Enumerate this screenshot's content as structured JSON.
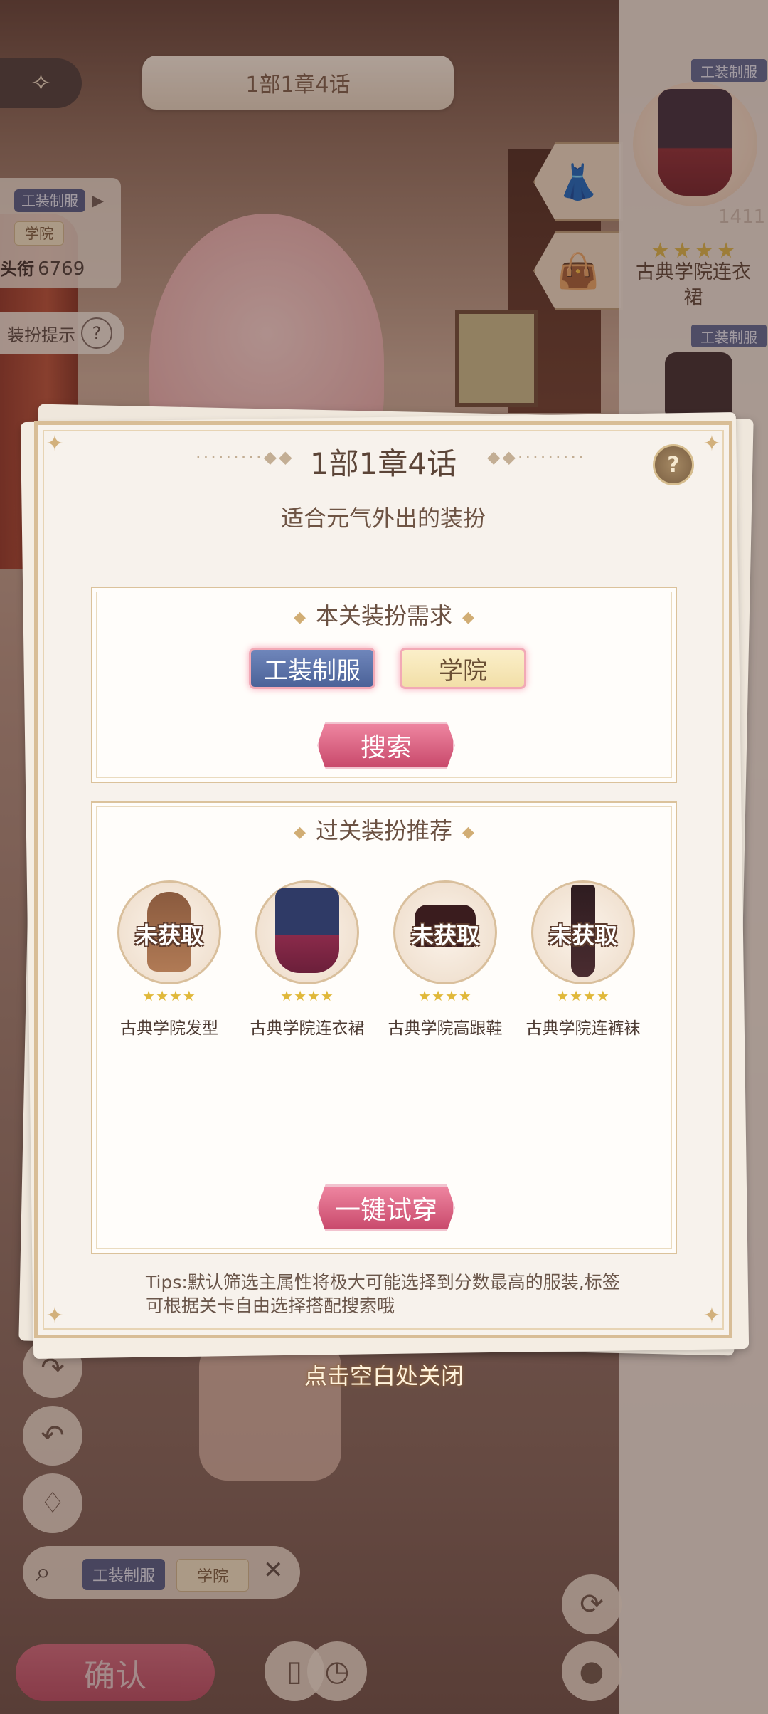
{
  "background": {
    "chapter_label": "1部1章4话",
    "back_icon": "ornament-back-icon",
    "left_panel": {
      "tag1": "工装制服",
      "tag2": "学院",
      "score_label": "头衔",
      "score_value": "6769"
    },
    "hint_label": "装扮提示",
    "hint_icon": "?",
    "right_panel": {
      "tag_top": "工装制服",
      "item_number": "1411",
      "item_stars": "★★★★",
      "item_name": "古典学院连衣裙",
      "tag_second": "工装制服"
    },
    "search_tags": [
      "工装制服",
      "学院"
    ],
    "confirm_label": "确认"
  },
  "modal": {
    "title": "1部1章4话",
    "title_decor_left": "·········◆◆",
    "title_decor_right": "◆◆·········",
    "help_icon": "?",
    "subtitle": "适合元气外出的装扮",
    "requirements": {
      "heading": "本关装扮需求",
      "tags": [
        "工装制服",
        "学院"
      ],
      "search_label": "搜索"
    },
    "recommend": {
      "heading": "过关装扮推荐",
      "items": [
        {
          "name": "古典学院发型",
          "stars": "★★★★",
          "status": "未获取",
          "icon": "hair-icon"
        },
        {
          "name": "古典学院连衣裙",
          "stars": "★★★★",
          "status": "",
          "icon": "dress-icon"
        },
        {
          "name": "古典学院高跟鞋",
          "stars": "★★★★",
          "status": "未获取",
          "icon": "shoes-icon"
        },
        {
          "name": "古典学院连裤袜",
          "stars": "★★★★",
          "status": "未获取",
          "icon": "stockings-icon"
        }
      ],
      "tryon_label": "一键试穿"
    },
    "tips": "Tips:默认筛选主属性将极大可能选择到分数最高的服装,标签可根据关卡自由选择搭配搜索哦",
    "diamond": "◆",
    "corner": "✦"
  },
  "close_hint": "点击空白处关闭",
  "colors": {
    "accent_pink": "#c94a6c",
    "tag_blue": "#4b6298",
    "frame_gold": "#d8bd96"
  }
}
